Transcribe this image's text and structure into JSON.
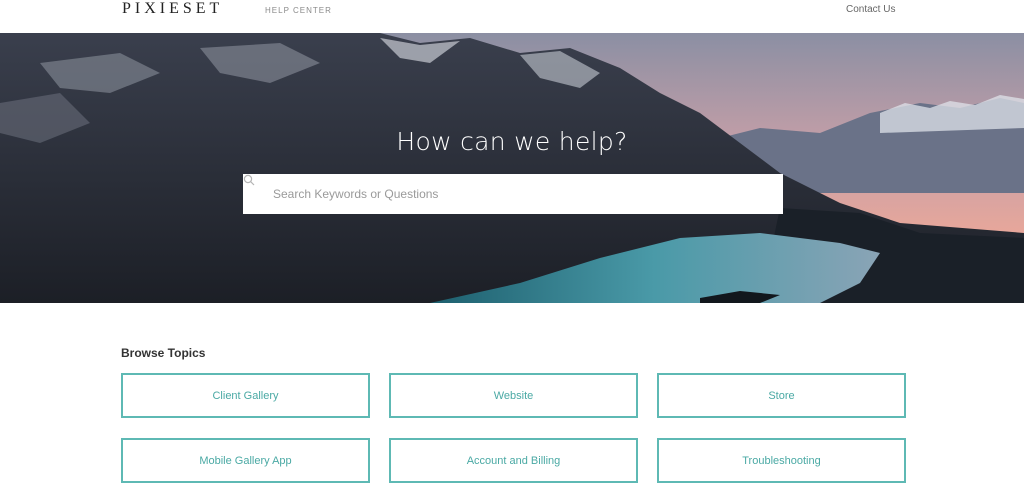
{
  "header": {
    "logo": "PIXIESET",
    "section_label": "HELP CENTER",
    "contact_label": "Contact Us"
  },
  "hero": {
    "title": "How can we help?",
    "search": {
      "placeholder": "Search Keywords or Questions",
      "icon": "search-icon"
    }
  },
  "browse": {
    "title": "Browse Topics",
    "topics": [
      {
        "label": "Client Gallery"
      },
      {
        "label": "Website"
      },
      {
        "label": "Store"
      },
      {
        "label": "Mobile Gallery App"
      },
      {
        "label": "Account and Billing"
      },
      {
        "label": "Troubleshooting"
      }
    ]
  },
  "colors": {
    "accent": "#5eb9b4",
    "accent_text": "#4aa9a4"
  }
}
